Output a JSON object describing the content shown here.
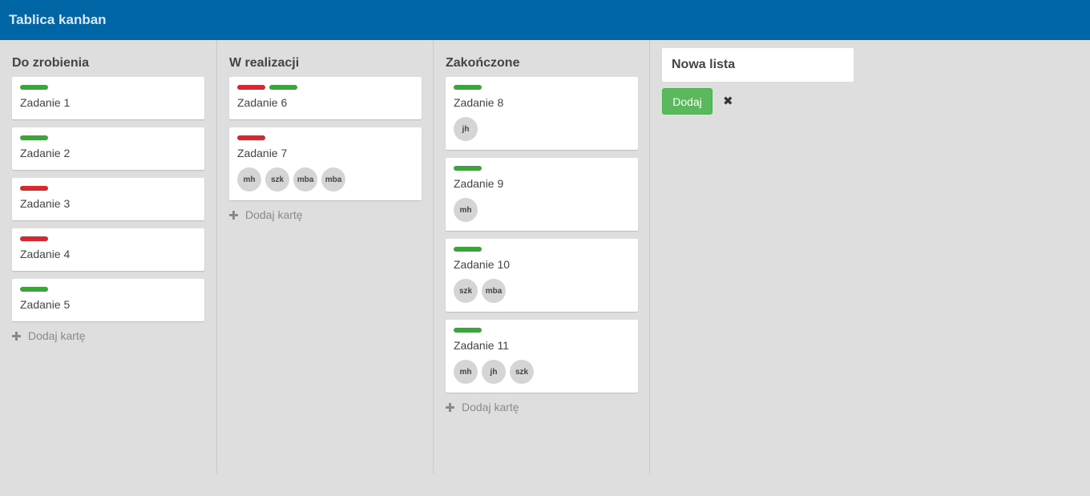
{
  "app": {
    "title": "Tablica kanban"
  },
  "colors": {
    "header": "#0065a5",
    "green_label": "#3aa53a",
    "red_label": "#d6282e"
  },
  "lists": [
    {
      "title": "Do zrobienia",
      "add_card_label": "Dodaj kartę",
      "cards": [
        {
          "title": "Zadanie 1",
          "labels": [
            "green"
          ],
          "members": []
        },
        {
          "title": "Zadanie 2",
          "labels": [
            "green"
          ],
          "members": []
        },
        {
          "title": "Zadanie 3",
          "labels": [
            "red"
          ],
          "members": []
        },
        {
          "title": "Zadanie 4",
          "labels": [
            "red"
          ],
          "members": []
        },
        {
          "title": "Zadanie 5",
          "labels": [
            "green"
          ],
          "members": []
        }
      ]
    },
    {
      "title": "W realizacji",
      "add_card_label": "Dodaj kartę",
      "cards": [
        {
          "title": "Zadanie 6",
          "labels": [
            "red",
            "green"
          ],
          "members": []
        },
        {
          "title": "Zadanie 7",
          "labels": [
            "red"
          ],
          "members": [
            "mh",
            "szk",
            "mba",
            "mba"
          ]
        }
      ]
    },
    {
      "title": "Zakończone",
      "add_card_label": "Dodaj kartę",
      "cards": [
        {
          "title": "Zadanie 8",
          "labels": [
            "green"
          ],
          "members": [
            "jh"
          ]
        },
        {
          "title": "Zadanie 9",
          "labels": [
            "green"
          ],
          "members": [
            "mh"
          ]
        },
        {
          "title": "Zadanie 10",
          "labels": [
            "green"
          ],
          "members": [
            "szk",
            "mba"
          ]
        },
        {
          "title": "Zadanie 11",
          "labels": [
            "green"
          ],
          "members": [
            "mh",
            "jh",
            "szk"
          ]
        }
      ]
    }
  ],
  "new_list": {
    "value": "Nowa lista",
    "placeholder": "",
    "add_button_label": "Dodaj",
    "close_icon": "close-icon"
  }
}
